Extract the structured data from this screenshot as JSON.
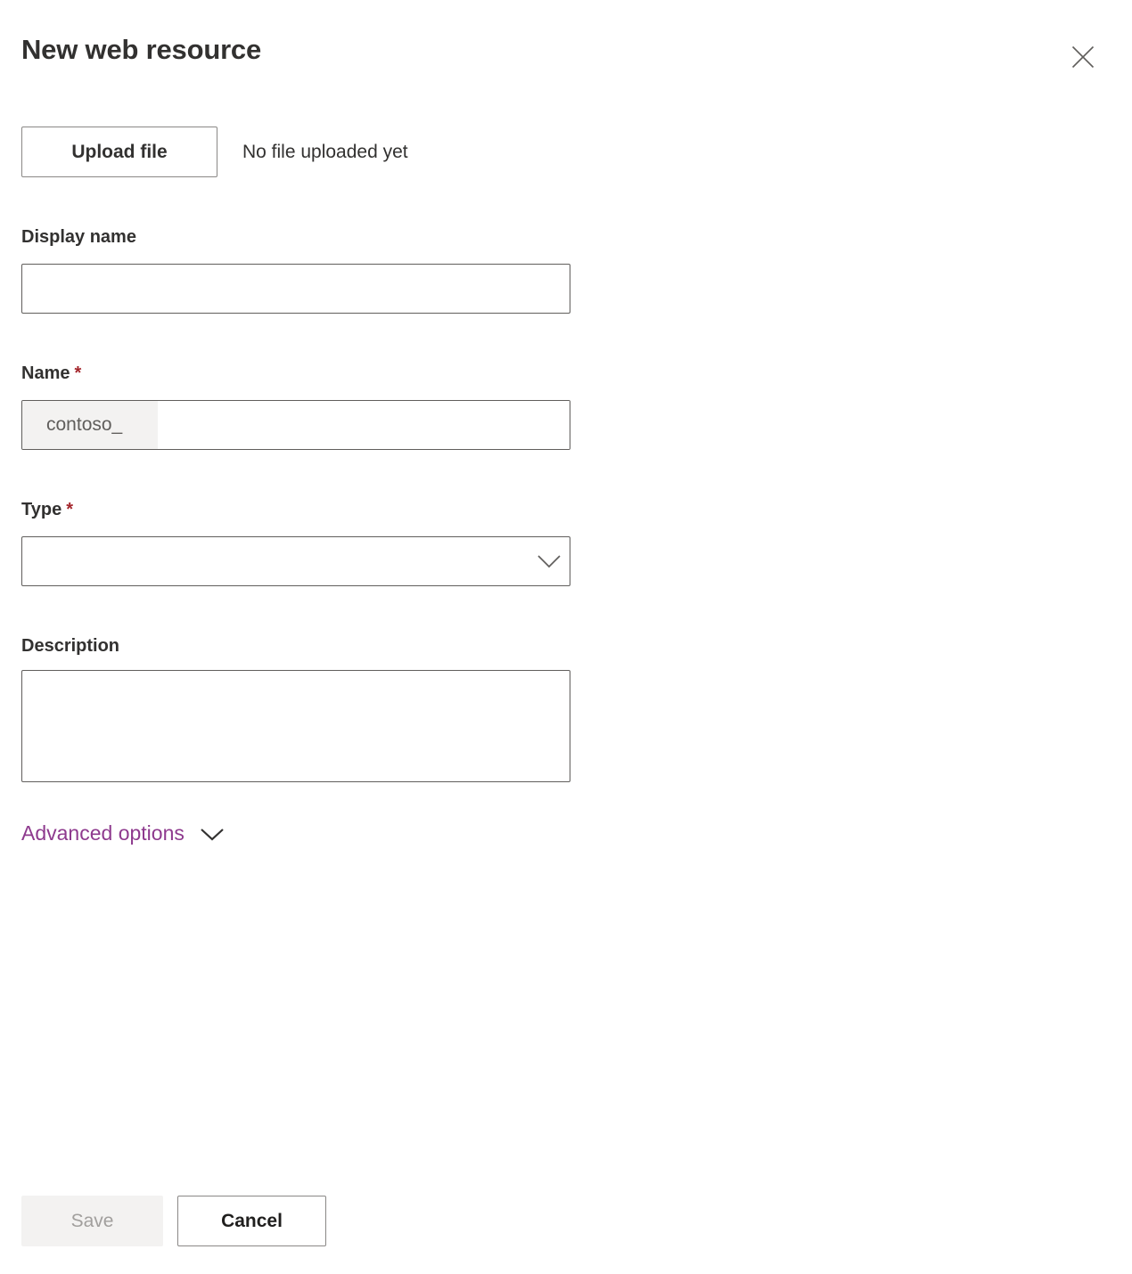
{
  "panel": {
    "title": "New web resource",
    "close_icon": "close-icon"
  },
  "upload": {
    "button_label": "Upload file",
    "status_text": "No file uploaded yet"
  },
  "fields": {
    "display_name": {
      "label": "Display name",
      "value": "",
      "placeholder": "",
      "required": false
    },
    "name": {
      "label": "Name",
      "required": true,
      "required_marker": "*",
      "prefix": "contoso_",
      "value": "",
      "placeholder": ""
    },
    "type": {
      "label": "Type",
      "required": true,
      "required_marker": "*",
      "selected": "",
      "chevron_icon": "chevron-down-icon"
    },
    "description": {
      "label": "Description",
      "value": "",
      "placeholder": "",
      "required": false
    }
  },
  "advanced_options": {
    "label": "Advanced options",
    "chevron_icon": "chevron-down-icon",
    "expanded": false
  },
  "footer": {
    "save_label": "Save",
    "save_disabled": true,
    "cancel_label": "Cancel"
  },
  "colors": {
    "accent_link": "#8e3a8e",
    "required_star": "#a4262c",
    "text_primary": "#323130",
    "border_input": "#605e5c",
    "border_button": "#8a8886",
    "disabled_bg": "#f3f2f1",
    "disabled_text": "#a19f9d",
    "prefix_bg": "#f3f2f1",
    "prefix_text": "#605e5c"
  }
}
